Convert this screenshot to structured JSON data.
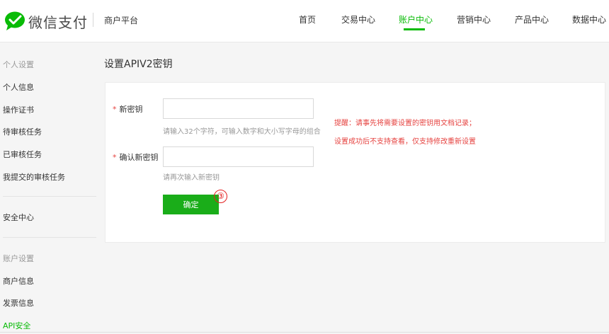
{
  "header": {
    "logo_text": "微信支付",
    "platform": "商户平台",
    "brand_color": "#09bb07",
    "nav": [
      {
        "label": "首页",
        "active": false
      },
      {
        "label": "交易中心",
        "active": false
      },
      {
        "label": "账户中心",
        "active": true
      },
      {
        "label": "营销中心",
        "active": false
      },
      {
        "label": "产品中心",
        "active": false
      },
      {
        "label": "数据中心",
        "active": false
      }
    ]
  },
  "sidebar": {
    "group1": "个人设置",
    "items1": [
      "个人信息",
      "操作证书",
      "待审核任务",
      "已审核任务",
      "我提交的审核任务"
    ],
    "security": "安全中心",
    "group2": "账户设置",
    "items2": [
      "商户信息",
      "发票信息",
      "API安全"
    ]
  },
  "main": {
    "title": "设置APIV2密钥",
    "required_mark": "*",
    "new_key_label": "新密钥",
    "new_key_value": "",
    "new_key_hint": "请输入32个字符，可输入数字和大小写字母的组合",
    "confirm_key_label": "确认新密钥",
    "confirm_key_value": "",
    "confirm_key_hint": "请再次输入新密钥",
    "tip_line1": "提醒：请事先将需要设置的密钥用文档记录；",
    "tip_line2": "设置成功后不支持查看，仅支持修改重新设置",
    "confirm_button": "确定",
    "step_badge": "③"
  }
}
